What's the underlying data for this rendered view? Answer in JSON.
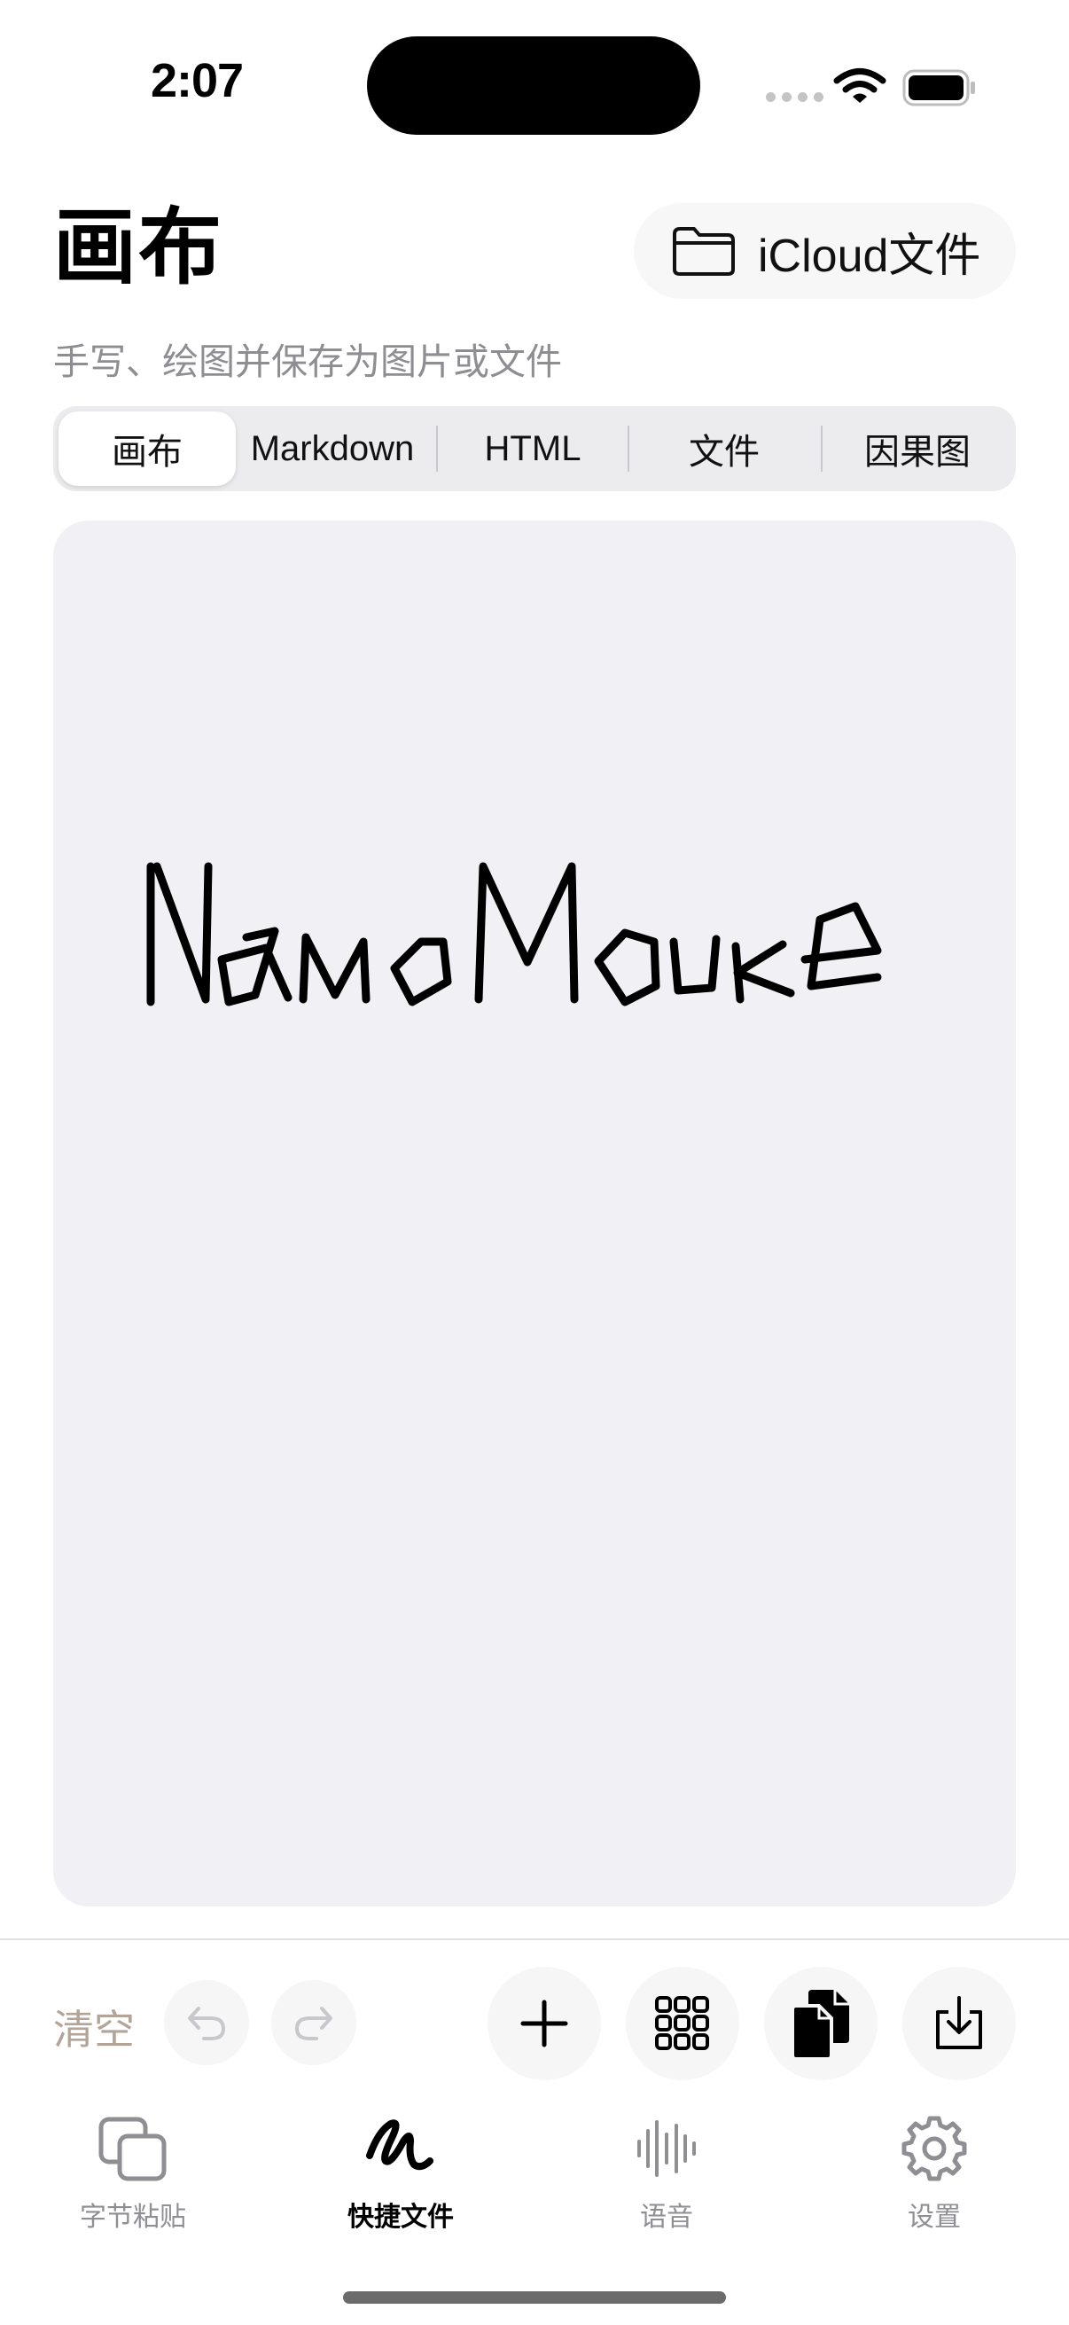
{
  "status_bar": {
    "time": "2:07"
  },
  "header": {
    "title": "画布",
    "subtitle": "手写、绘图并保存为图片或文件",
    "icloud_button_label": "iCloud文件",
    "icloud_icon": "folder-icon"
  },
  "segmented_control": {
    "selected": "画布",
    "segments": [
      "画布",
      "Markdown",
      "HTML",
      "文件",
      "因果图"
    ]
  },
  "canvas": {
    "handwriting": "NamoMouke"
  },
  "toolbar": {
    "clear_label": "清空",
    "undo_icon": "undo-arrow-icon",
    "redo_icon": "redo-arrow-icon",
    "add_icon": "plus-icon",
    "grid_icon": "grid-icon",
    "copy_icon": "copy-documents-icon",
    "export_icon": "download-tray-icon"
  },
  "tab_bar": {
    "tabs": [
      {
        "label": "字节粘贴",
        "icon": "stacked-squares-icon",
        "active": false
      },
      {
        "label": "快捷文件",
        "icon": "scribble-icon",
        "active": true
      },
      {
        "label": "语音",
        "icon": "waveform-icon",
        "active": false
      },
      {
        "label": "设置",
        "icon": "gear-icon",
        "active": false
      }
    ]
  },
  "colors": {
    "background": "#ffffff",
    "canvas": "#f1f1f5",
    "secondary_text": "#8d8d92",
    "clear_text": "#b2a597"
  }
}
